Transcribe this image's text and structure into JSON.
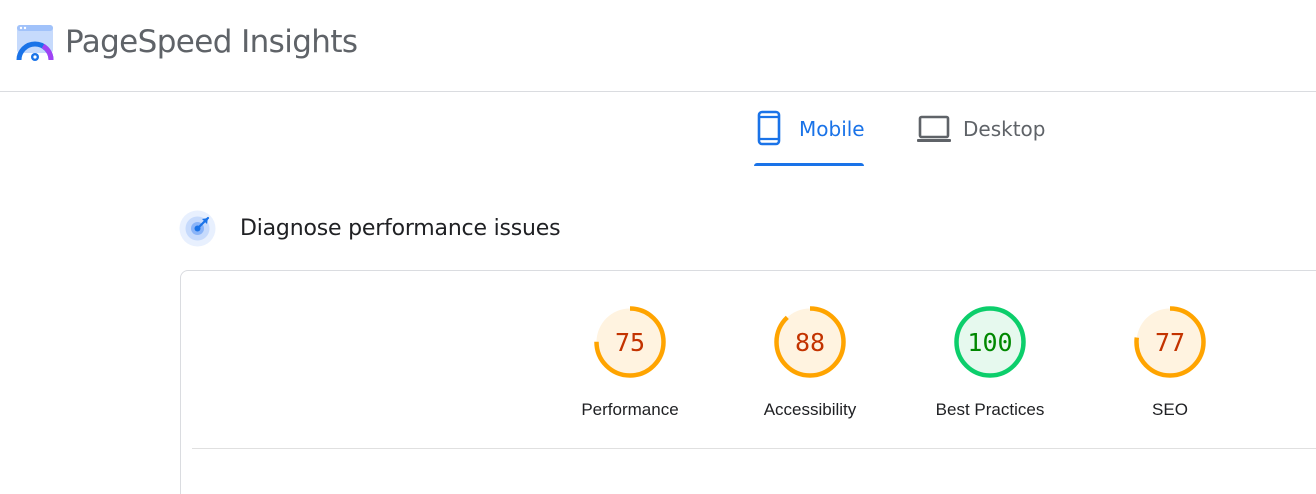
{
  "app": {
    "title": "PageSpeed Insights"
  },
  "tabs": [
    {
      "label": "Mobile",
      "icon": "phone-icon",
      "active": true
    },
    {
      "label": "Desktop",
      "icon": "laptop-icon",
      "active": false
    }
  ],
  "section": {
    "title": "Diagnose performance issues",
    "icon": "diagnostics-icon"
  },
  "scores": [
    {
      "label": "Performance",
      "value": "75",
      "color": "#ffa400",
      "fill": "#fff3e0",
      "text_color": "#c33300"
    },
    {
      "label": "Accessibility",
      "value": "88",
      "color": "#ffa400",
      "fill": "#fff3e0",
      "text_color": "#c33300"
    },
    {
      "label": "Best Practices",
      "value": "100",
      "color": "#0cce6b",
      "fill": "#e6f9ee",
      "text_color": "#008800"
    },
    {
      "label": "SEO",
      "value": "77",
      "color": "#ffa400",
      "fill": "#fff3e0",
      "text_color": "#c33300"
    }
  ],
  "colors": {
    "accent": "#1a73e8",
    "muted": "#5f6368",
    "border": "#dadce0"
  }
}
